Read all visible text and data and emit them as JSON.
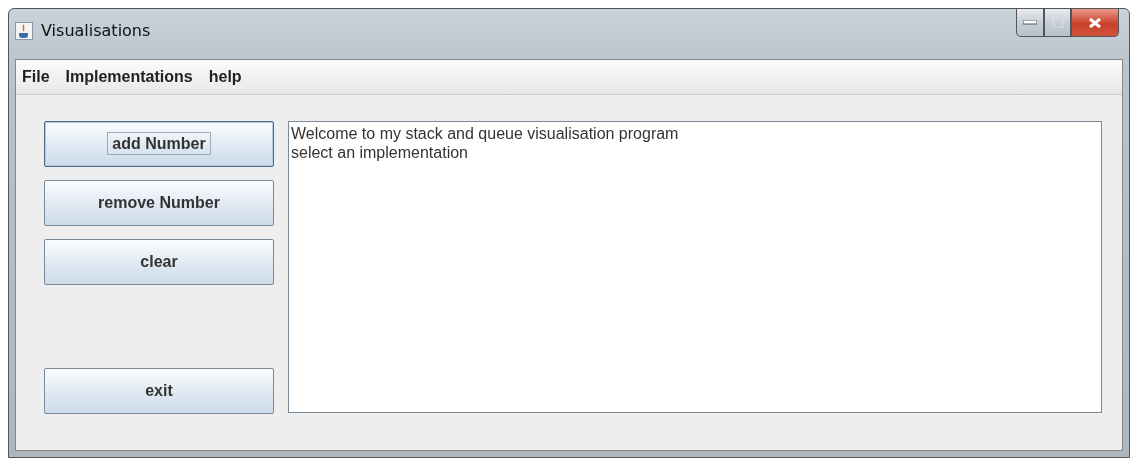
{
  "window": {
    "title": "Visualisations"
  },
  "menu": [
    "File",
    "Implementations",
    "help"
  ],
  "buttons": [
    {
      "label": "add Number",
      "focused": true
    },
    {
      "label": "remove Number",
      "focused": false
    },
    {
      "label": "clear",
      "focused": false
    },
    {
      "label": "exit",
      "focused": false
    }
  ],
  "text_area": {
    "lines": [
      "Welcome to my stack and queue visualisation program",
      "select an implementation"
    ]
  }
}
